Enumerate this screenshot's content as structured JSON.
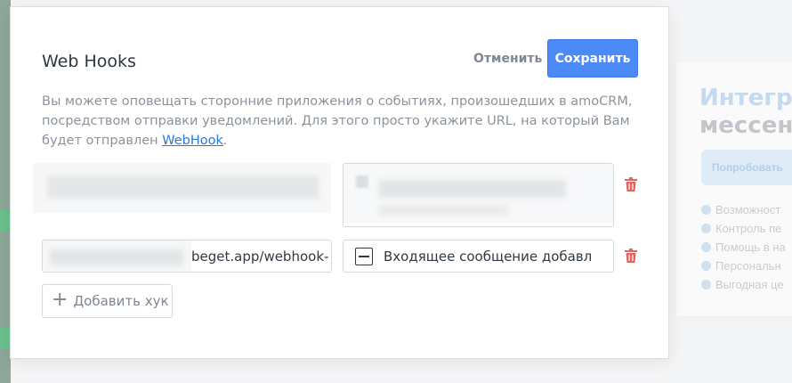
{
  "background": {
    "card": {
      "heading_line1": "Интегра",
      "heading_line2": "мессен",
      "try_button": "Попробовать",
      "features": [
        "Возможност",
        "Контроль пе",
        "Помощь в на",
        "Персональн",
        "Выгодная це"
      ]
    }
  },
  "modal": {
    "title": "Web Hooks",
    "cancel_label": "Отменить",
    "save_label": "Сохранить",
    "description": "Вы можете оповещать сторонние приложения о событиях, произошедших в amoCRM, посредством отправки уведомлений. Для этого просто укажите URL, на который Вам будет отправлен ",
    "description_link": "WebHook",
    "description_end": ".",
    "hooks": [
      {
        "url": "",
        "event": ""
      },
      {
        "url": "beget.app/webhook-",
        "event": "Входящее сообщение добавл"
      }
    ],
    "add_hook_label": "Добавить хук",
    "colors": {
      "accent": "#4c8bf7",
      "link": "#2c7ad6",
      "delete": "#e06666"
    }
  }
}
